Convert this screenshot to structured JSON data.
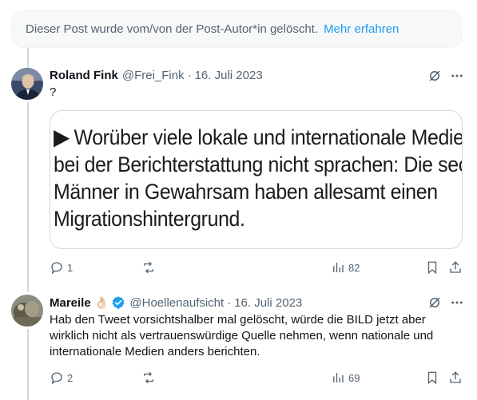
{
  "deleted_notice": {
    "text": "Dieser Post wurde vom/von der Post-Autor*in gelöscht.",
    "link": "Mehr erfahren"
  },
  "tweets": [
    {
      "name": "Roland Fink",
      "handle": "@Frei_Fink",
      "separator": "·",
      "date": "16. Juli 2023",
      "text": "?",
      "media_text": {
        "line1": "Worüber viele lokale und internationale Medien",
        "line2": "bei der Berichterstattung nicht sprachen: Die sechs",
        "line3": "Männer in Gewahrsam haben allesamt einen",
        "line4": "Migrationshintergrund."
      },
      "replies": "1",
      "reposts": "",
      "views": "82"
    },
    {
      "name": "Mareile",
      "name_emoji": "👌🏻",
      "handle": "@Hoellenaufsicht",
      "separator": "·",
      "date": "16. Juli 2023",
      "text": "Hab den Tweet vorsichtshalber mal gelöscht, würde die BILD jetzt aber wirklich nicht als vertrauenswürdige Quelle nehmen, wenn nationale und internationale Medien anders berichten.",
      "replies": "2",
      "reposts": "",
      "views": "69"
    }
  ],
  "colors": {
    "accent": "#1d9bf0",
    "secondary_text": "#536471",
    "border": "#cfd9de"
  },
  "icons": [
    "grok-icon",
    "more-icon",
    "reply-icon",
    "repost-icon",
    "views-icon",
    "bookmark-icon",
    "share-icon",
    "verified-badge-icon"
  ]
}
